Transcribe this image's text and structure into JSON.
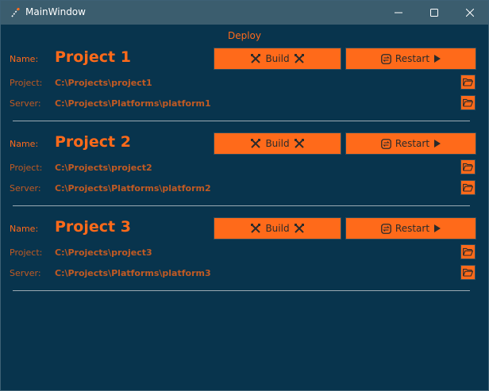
{
  "window": {
    "title": "MainWindow"
  },
  "header": {
    "deploy_label": "Deploy"
  },
  "labels": {
    "name": "Name:",
    "project": "Project:",
    "server": "Server:"
  },
  "buttons": {
    "build": "Build",
    "restart": "Restart"
  },
  "icons": {
    "build": "tools-icon",
    "restart": "swap-icon",
    "play": "play-icon",
    "folder": "folder-open-icon"
  },
  "colors": {
    "background": "#08344d",
    "accent": "#ff6a1a",
    "muted_accent": "#c15a23",
    "titlebar": "#3b5d6e"
  },
  "projects": [
    {
      "name": "Project 1",
      "project_path": "C:\\Projects\\project1",
      "server_path": "C:\\Projects\\Platforms\\platform1"
    },
    {
      "name": "Project 2",
      "project_path": "C:\\Projects\\project2",
      "server_path": "C:\\Projects\\Platforms\\platform2"
    },
    {
      "name": "Project 3",
      "project_path": "C:\\Projects\\project3",
      "server_path": "C:\\Projects\\Platforms\\platform3"
    }
  ]
}
